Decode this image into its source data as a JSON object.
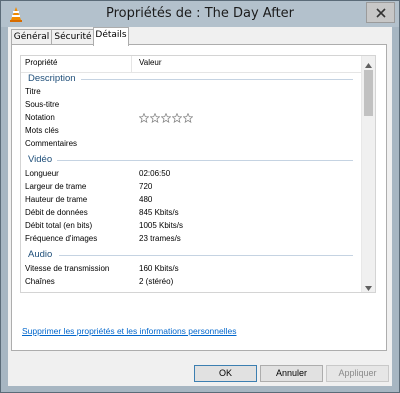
{
  "window": {
    "title": "Propriétés de : The Day After",
    "app_icon": "vlc-cone-icon",
    "close_icon": "close-x-icon"
  },
  "tabs": [
    {
      "label": "Général",
      "active": false
    },
    {
      "label": "Sécurité",
      "active": false
    },
    {
      "label": "Détails",
      "active": true
    }
  ],
  "grid": {
    "headers": {
      "property": "Propriété",
      "value": "Valeur"
    },
    "groups": {
      "description": {
        "label": "Description",
        "rows": [
          {
            "property": "Titre",
            "value": ""
          },
          {
            "property": "Sous-titre",
            "value": ""
          },
          {
            "property": "Notation",
            "rating": 0,
            "rating_max": 5
          },
          {
            "property": "Mots clés",
            "value": ""
          },
          {
            "property": "Commentaires",
            "value": ""
          }
        ]
      },
      "video": {
        "label": "Vidéo",
        "rows": [
          {
            "property": "Longueur",
            "value": "02:06:50"
          },
          {
            "property": "Largeur de trame",
            "value": "720"
          },
          {
            "property": "Hauteur de trame",
            "value": "480"
          },
          {
            "property": "Débit de données",
            "value": "845 Kbits/s"
          },
          {
            "property": "Débit total (en bits)",
            "value": "1005 Kbits/s"
          },
          {
            "property": "Fréquence d'images",
            "value": "23 trames/s"
          }
        ]
      },
      "audio": {
        "label": "Audio",
        "rows": [
          {
            "property": "Vitesse de transmission",
            "value": "160 Kbits/s"
          },
          {
            "property": "Chaînes",
            "value": "2 (stéréo)"
          }
        ]
      }
    },
    "scroll_position": 0.0
  },
  "remove_link": "Supprimer les propriétés et les informations personnelles",
  "buttons": {
    "ok": "OK",
    "cancel": "Annuler",
    "apply": "Appliquer"
  },
  "colors": {
    "group_label": "#1e4e79",
    "link": "#0066cc",
    "titlebar": "#b3c1cc"
  }
}
